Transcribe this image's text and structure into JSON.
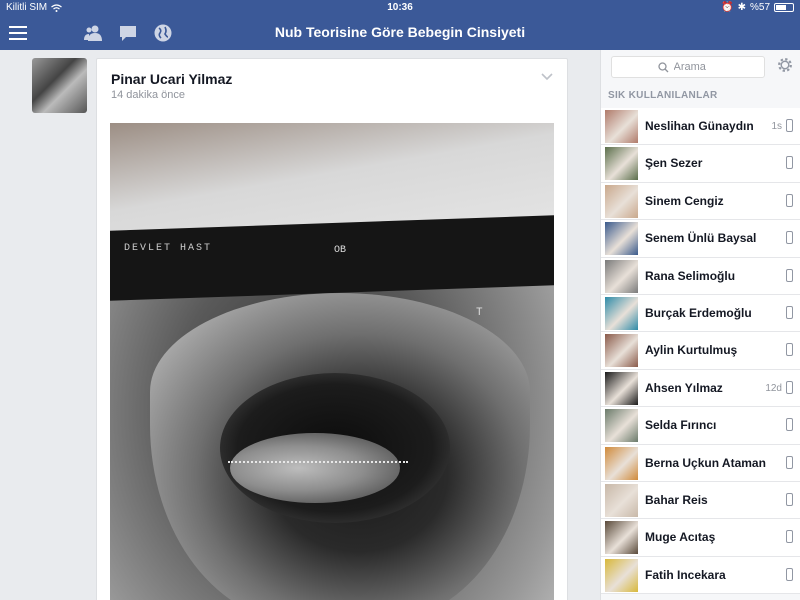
{
  "status_bar": {
    "carrier": "Kilitli SIM",
    "time": "10:36",
    "battery": "%57"
  },
  "header": {
    "title": "Nub Teorisine Göre Bebegin Cinsiyeti"
  },
  "icons": [
    "menu-icon",
    "friends-icon",
    "messages-icon",
    "globe-icon",
    "search-icon",
    "gear-icon",
    "chevron-down-icon",
    "mobile-icon"
  ],
  "post": {
    "author": "Pinar Ucari Yilmaz",
    "time": "14 dakika önce",
    "photo_text": {
      "band": "DEVLET HAST",
      "ob": "OB",
      "t": "T"
    }
  },
  "sidebar": {
    "search_placeholder": "Arama",
    "section_title": "SIK KULLANILANLAR",
    "contacts": [
      {
        "name": "Neslihan Günaydın",
        "ago": "1s",
        "color": "#b07a6a"
      },
      {
        "name": "Şen Sezer",
        "ago": "",
        "color": "#5a6e4a"
      },
      {
        "name": "Sinem Cengiz",
        "ago": "",
        "color": "#c9a88c"
      },
      {
        "name": "Senem Ünlü Baysal",
        "ago": "",
        "color": "#3a5a8c"
      },
      {
        "name": "Rana Selimoğlu",
        "ago": "",
        "color": "#7a7a7a"
      },
      {
        "name": "Burçak Erdemoğlu",
        "ago": "",
        "color": "#2e8ba8"
      },
      {
        "name": "Aylin Kurtulmuş",
        "ago": "",
        "color": "#8a5a4a"
      },
      {
        "name": "Ahsen Yılmaz",
        "ago": "12d",
        "color": "#1a1a1a"
      },
      {
        "name": "Selda Fırıncı",
        "ago": "",
        "color": "#6a7a6a"
      },
      {
        "name": "Berna Uçkun Ataman",
        "ago": "",
        "color": "#d08a3a"
      },
      {
        "name": "Bahar Reis",
        "ago": "",
        "color": "#c8b8a8"
      },
      {
        "name": "Muge Acıtaş",
        "ago": "",
        "color": "#5a4a3a"
      },
      {
        "name": "Fatih Incekara",
        "ago": "",
        "color": "#d8b83a"
      }
    ]
  }
}
